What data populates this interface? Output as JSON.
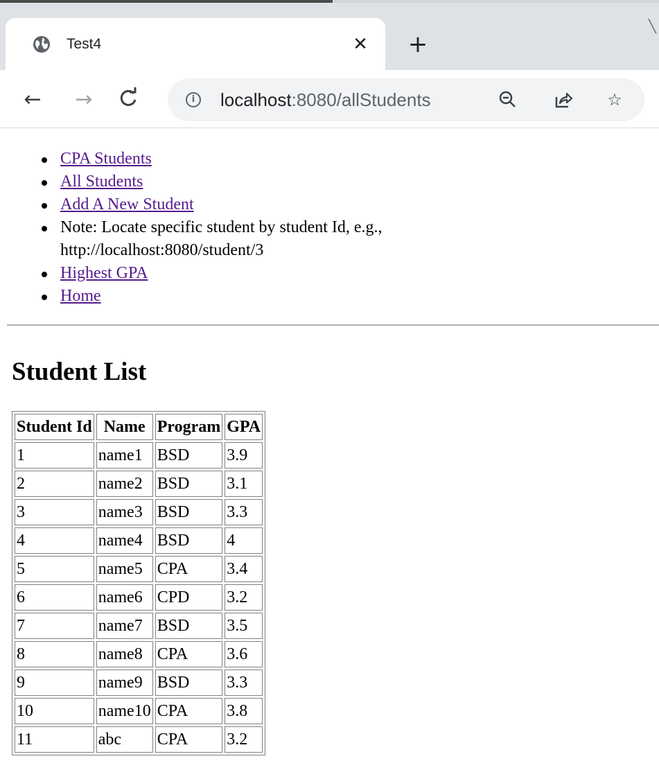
{
  "browser": {
    "tab_title": "Test4",
    "url_host": "localhost",
    "url_rest": ":8080/allStudents"
  },
  "nav": {
    "items": [
      {
        "label": "CPA Students",
        "link": true
      },
      {
        "label": "All Students",
        "link": true
      },
      {
        "label": "Add A New Student",
        "link": true
      },
      {
        "label": "Note: Locate specific student by student Id, e.g., http://localhost:8080/student/3",
        "link": false
      },
      {
        "label": "Highest GPA",
        "link": true
      },
      {
        "label": "Home",
        "link": true
      }
    ]
  },
  "main": {
    "title": "Student List",
    "table": {
      "headers": [
        "Student Id",
        "Name",
        "Program",
        "GPA"
      ],
      "rows": [
        [
          "1",
          "name1",
          "BSD",
          "3.9"
        ],
        [
          "2",
          "name2",
          "BSD",
          "3.1"
        ],
        [
          "3",
          "name3",
          "BSD",
          "3.3"
        ],
        [
          "4",
          "name4",
          "BSD",
          "4"
        ],
        [
          "5",
          "name5",
          "CPA",
          "3.4"
        ],
        [
          "6",
          "name6",
          "CPD",
          "3.2"
        ],
        [
          "7",
          "name7",
          "BSD",
          "3.5"
        ],
        [
          "8",
          "name8",
          "CPA",
          "3.6"
        ],
        [
          "9",
          "name9",
          "BSD",
          "3.3"
        ],
        [
          "10",
          "name10",
          "CPA",
          "3.8"
        ],
        [
          "11",
          "abc",
          "CPA",
          "3.2"
        ]
      ]
    }
  },
  "icons": {
    "tab": "globe-icon",
    "close": "close-icon",
    "new_tab": "plus-icon",
    "back": "back-arrow-icon",
    "forward": "forward-arrow-icon",
    "reload": "reload-icon",
    "info": "info-icon",
    "zoom": "zoom-out-icon",
    "share": "share-icon",
    "bookmark": "star-icon"
  },
  "colors": {
    "visited_link": "#551a8b",
    "chrome_frame": "#dee1e6",
    "omnibox": "#f1f3f4"
  }
}
